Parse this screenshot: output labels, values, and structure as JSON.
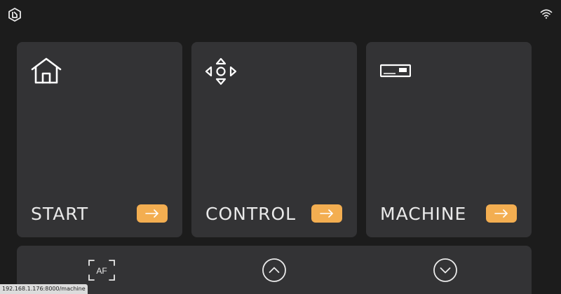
{
  "header": {
    "logo_icon": "app-logo-icon",
    "wifi_icon": "wifi-icon"
  },
  "cards": [
    {
      "label": "START",
      "icon": "home-icon"
    },
    {
      "label": "CONTROL",
      "icon": "move-arrows-icon"
    },
    {
      "label": "MACHINE",
      "icon": "machine-icon"
    }
  ],
  "bottom_bar": {
    "af_label": "AF",
    "up_icon": "chevron-up-icon",
    "down_icon": "chevron-down-icon"
  },
  "status_url": "192.168.1.176:8000/machine",
  "colors": {
    "background": "#1c1c1c",
    "card": "#333335",
    "accent": "#f3ae51",
    "text": "#e9e9e9"
  }
}
